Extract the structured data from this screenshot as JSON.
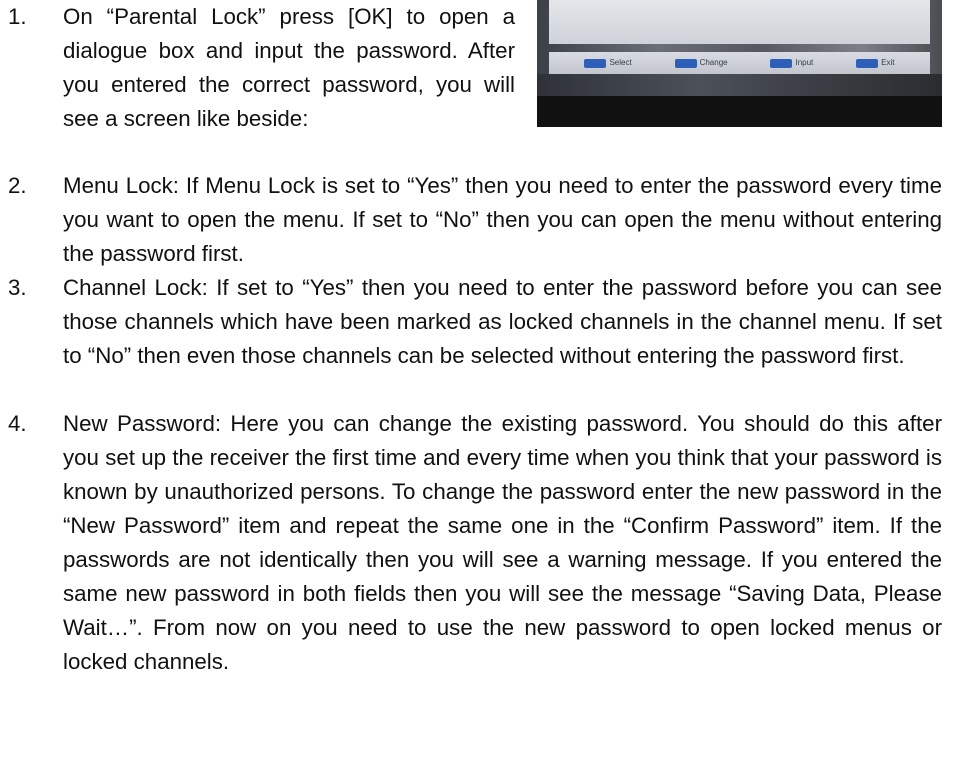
{
  "items": [
    {
      "number": "1.",
      "text": "On “Parental Lock” press [OK] to open a dialogue box and input the password. After you entered the correct password, you will see a screen like beside:"
    },
    {
      "number": "2.",
      "text": "Menu Lock: If Menu Lock is set to “Yes” then you need to enter the password every time you want to open the menu. If set to “No” then you can open the menu without entering the password first."
    },
    {
      "number": "3.",
      "text": "Channel Lock: If set to “Yes” then you need to enter the password before you can see those channels which have been marked as locked channels in the channel menu. If set to “No” then even those channels can be selected without entering the password first."
    },
    {
      "number": "4.",
      "text": "New Password: Here you can change the existing password. You should do this after you set up the receiver the first time and every time when you think that your password is known by unauthorized persons. To change the password enter the new password in the “New Password” item and repeat the same one in the “Confirm Password” item. If the passwords are not identically then you will see a warning message. If you entered the same new password in both fields then you will see the message “Saving Data, Please Wait…”. From now on you need to use the new password to open locked menus or locked channels."
    }
  ],
  "screenshot": {
    "hints": [
      {
        "icon": "up-down-key-icon",
        "label": "Select"
      },
      {
        "icon": "left-right-key-icon",
        "label": "Change"
      },
      {
        "icon": "number-keys-icon",
        "label": "Input"
      },
      {
        "icon": "exit-key-icon",
        "label": "Exit"
      }
    ],
    "key_color": "#2b5fb8"
  }
}
